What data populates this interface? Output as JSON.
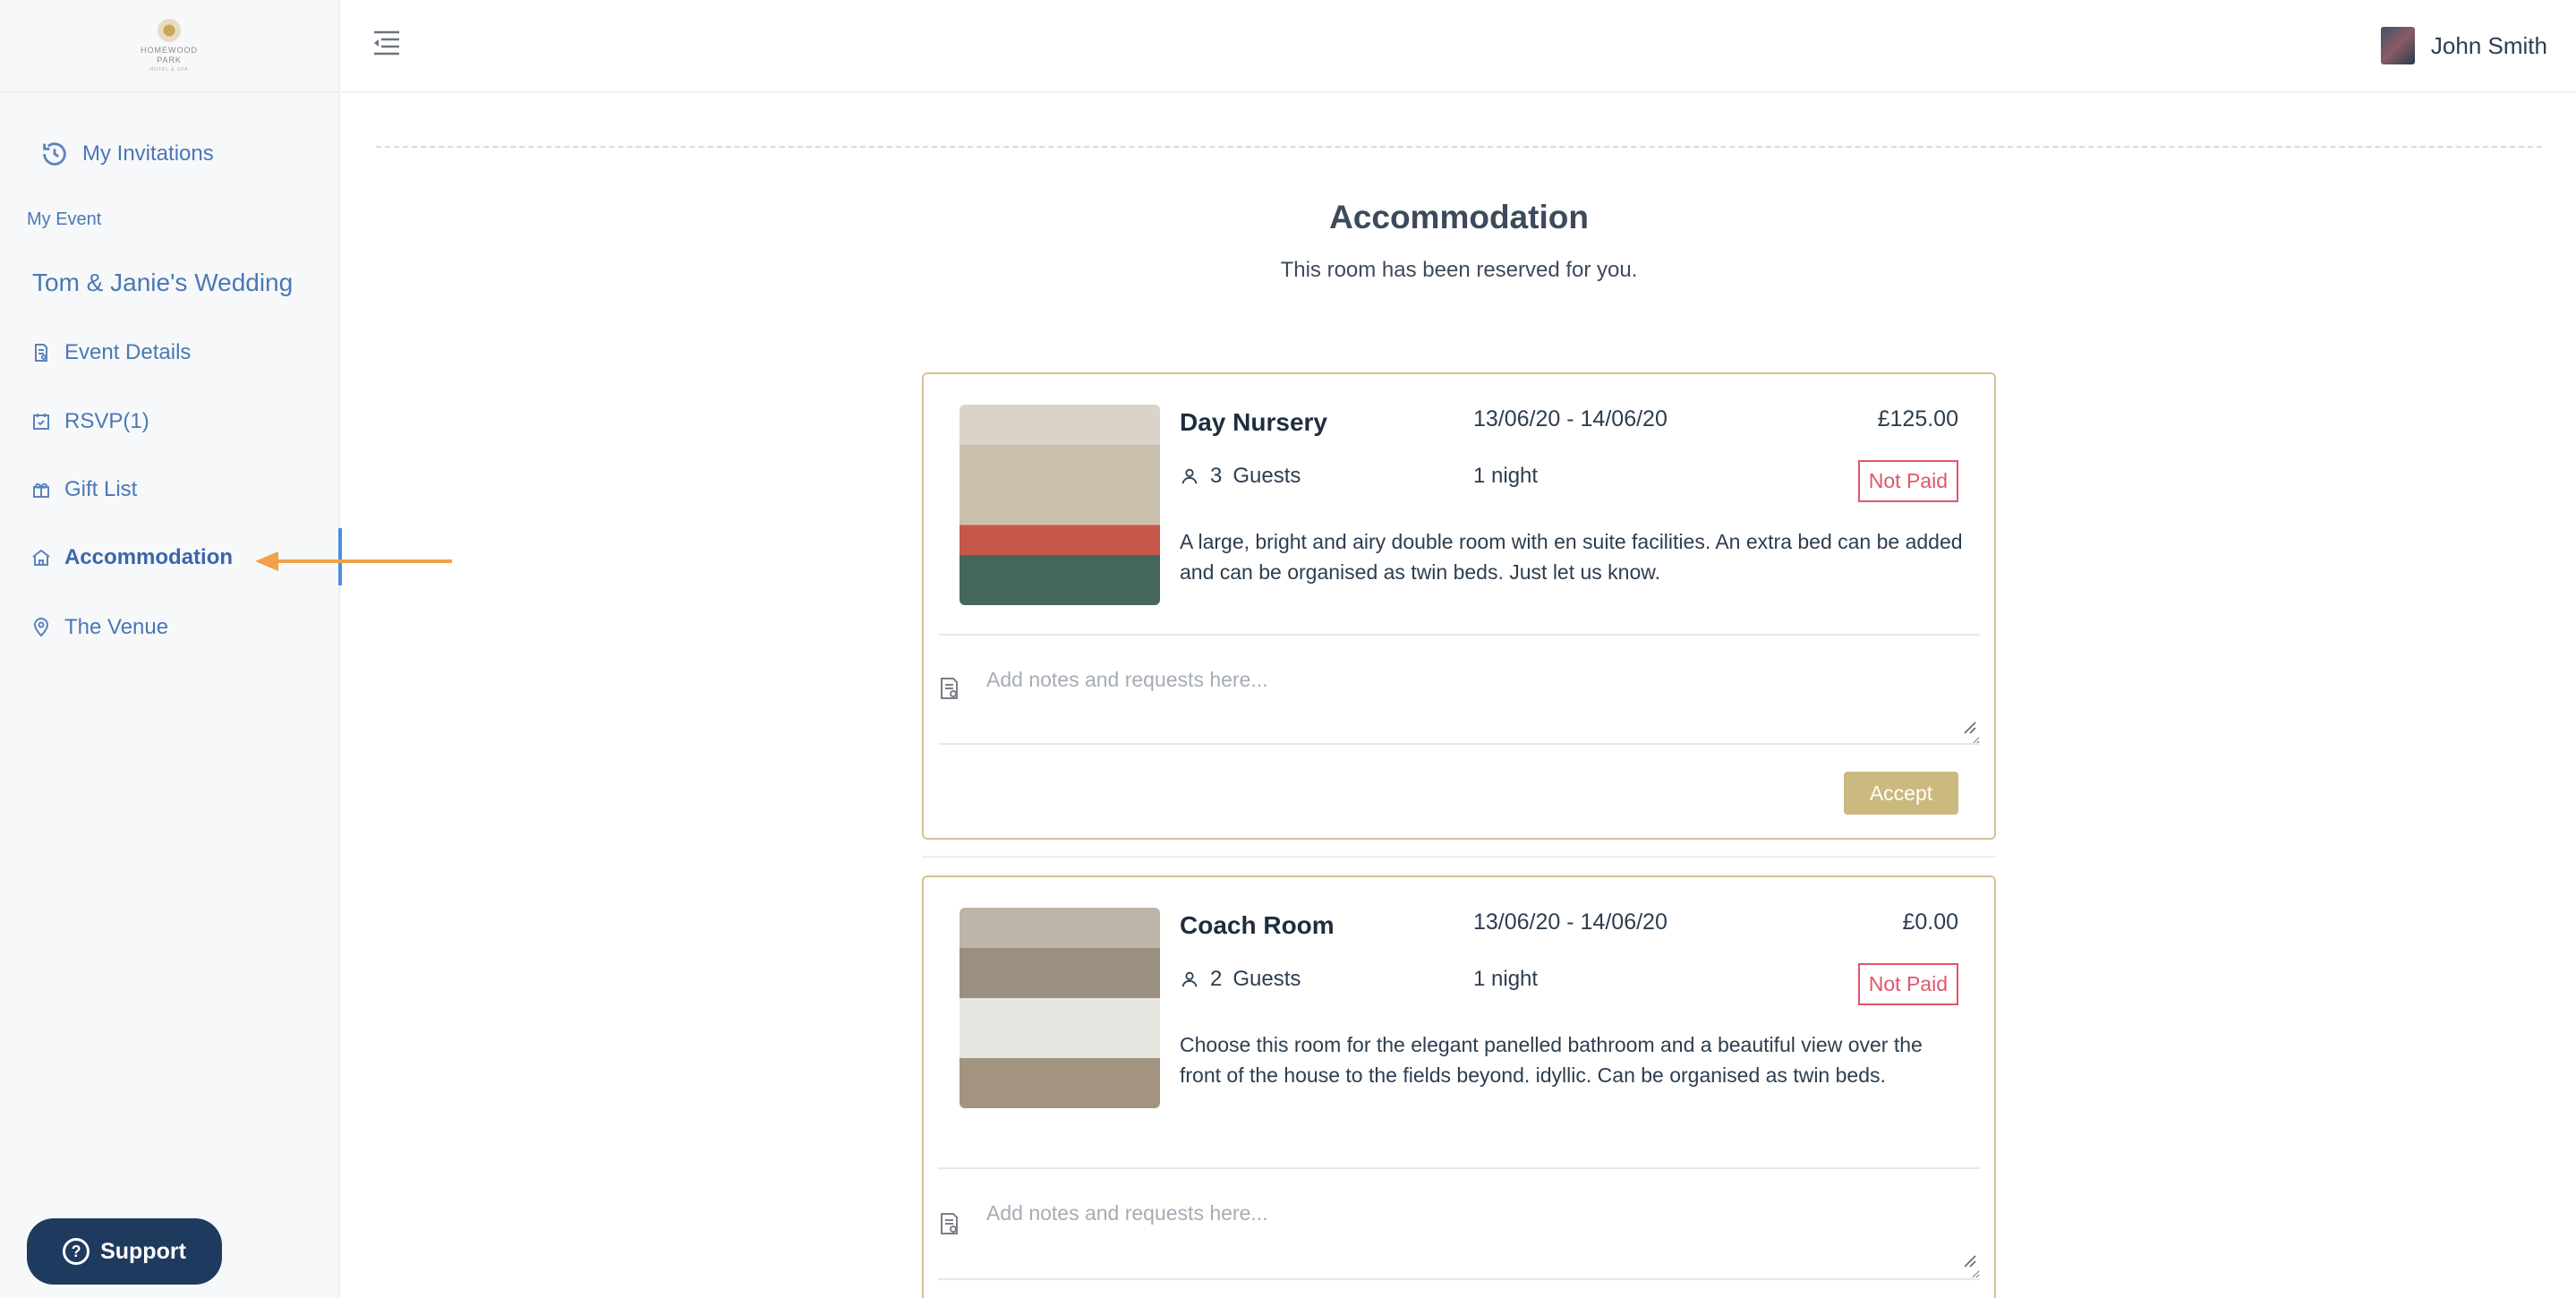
{
  "logo": {
    "line1": "HOMEWOOD",
    "line2": "PARK",
    "tagline": "HOTEL & SPA"
  },
  "sidebar": {
    "invitations_label": "My Invitations",
    "section_label": "My Event",
    "event_name": "Tom & Janie's Wedding",
    "items": [
      {
        "label": "Event Details",
        "icon": "document-icon"
      },
      {
        "label": "RSVP(1)",
        "icon": "calendar-check-icon"
      },
      {
        "label": "Gift List",
        "icon": "gift-icon"
      },
      {
        "label": "Accommodation",
        "icon": "home-icon",
        "active": true
      },
      {
        "label": "The Venue",
        "icon": "map-pin-icon"
      }
    ],
    "support_label": "Support"
  },
  "header": {
    "user_name": "John Smith"
  },
  "page": {
    "title": "Accommodation",
    "subtitle": "This room has been reserved for you."
  },
  "rooms": [
    {
      "name": "Day Nursery",
      "dates": "13/06/20 - 14/06/20",
      "price": "£125.00",
      "guests_count": "3",
      "guests_label": "Guests",
      "nights": "1 night",
      "status": "Not Paid",
      "description": "A large, bright and airy double room with en suite facilities. An extra bed can be added and can be organised as twin beds. Just let us know.",
      "notes_placeholder": "Add notes and requests here...",
      "accept_label": "Accept"
    },
    {
      "name": "Coach Room",
      "dates": "13/06/20 - 14/06/20",
      "price": "£0.00",
      "guests_count": "2",
      "guests_label": "Guests",
      "nights": "1 night",
      "status": "Not Paid",
      "description": "Choose this room for the elegant panelled bathroom and a beautiful view over the front of the house to the fields beyond. idyllic. Can be organised as twin beds.",
      "notes_placeholder": "Add notes and requests here..."
    }
  ],
  "colors": {
    "accent": "#cbb97f",
    "nav": "#4a78b5",
    "unpaid": "#e0566a",
    "arrow": "#f0a14a"
  }
}
